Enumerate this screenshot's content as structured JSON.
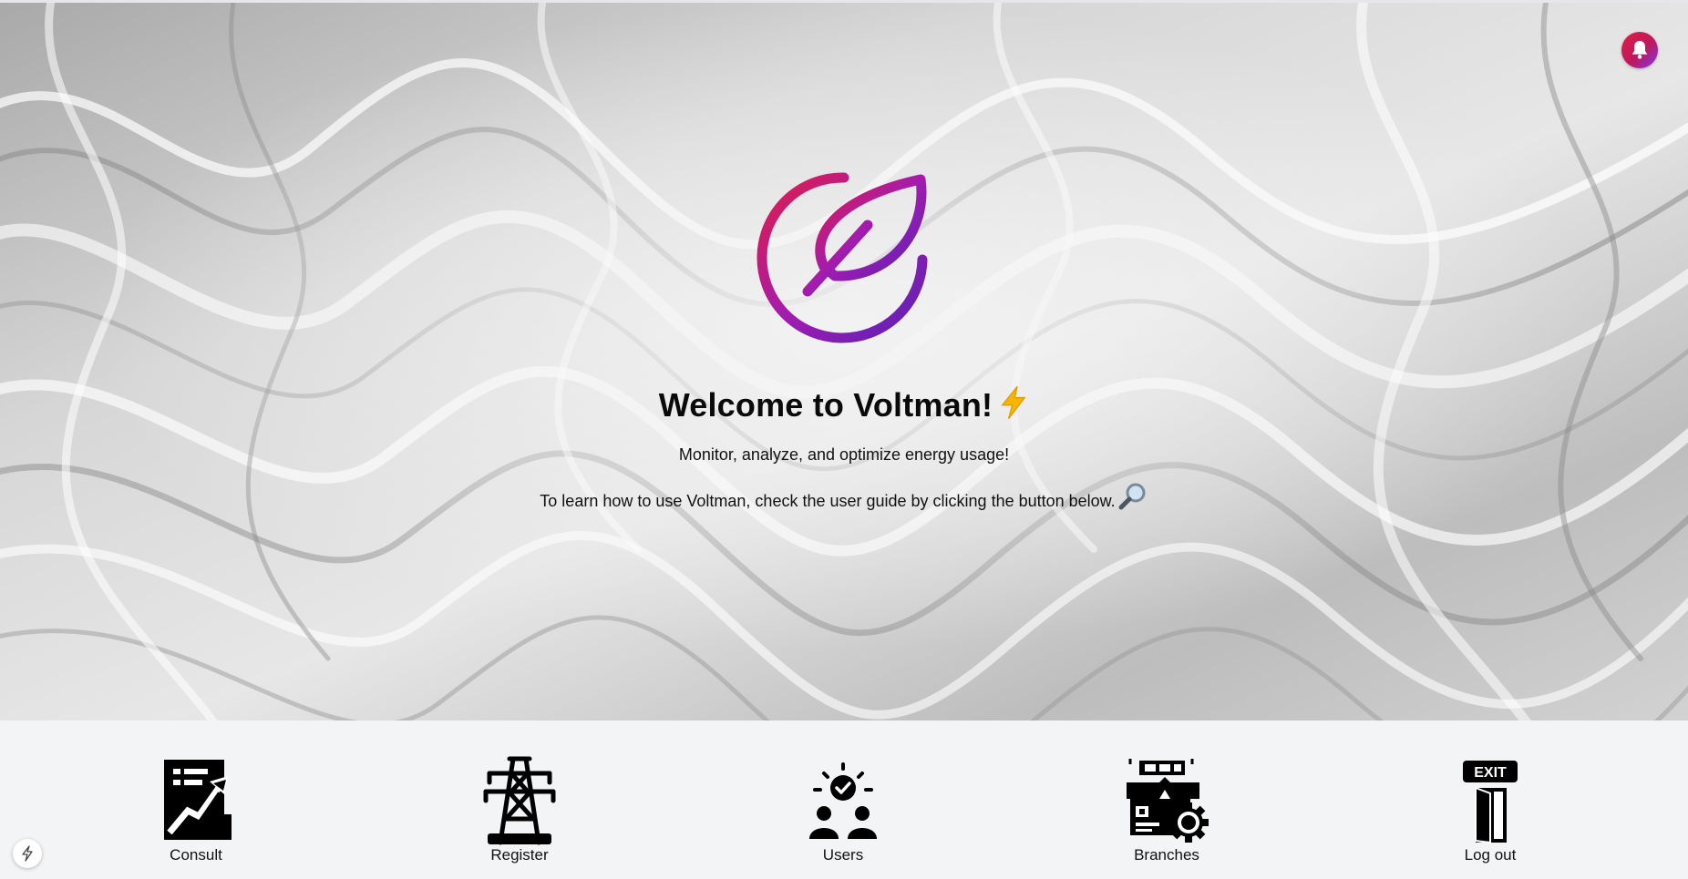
{
  "hero": {
    "headline": "Welcome to Voltman!",
    "headline_emoji_icon": "high-voltage-icon",
    "subtitle": "Monitor, analyze, and optimize energy usage!",
    "guide_text": "To learn how to use Voltman, check the user guide by clicking the button below.",
    "guide_emoji_icon": "magnifying-glass-icon",
    "logo_icon": "leaf-power-logo",
    "notification_icon": "bell-icon"
  },
  "nav": {
    "items": [
      {
        "label": "Consult",
        "icon": "chart-document-icon"
      },
      {
        "label": "Register",
        "icon": "power-tower-icon"
      },
      {
        "label": "Users",
        "icon": "users-check-icon"
      },
      {
        "label": "Branches",
        "icon": "factory-gear-icon"
      },
      {
        "label": "Log out",
        "icon": "exit-door-icon"
      }
    ]
  },
  "colors": {
    "accent_start": "#e11d48",
    "accent_mid": "#be185d",
    "accent_end": "#6d28d9",
    "nav_background": "#f3f4f6",
    "text": "#111111"
  }
}
